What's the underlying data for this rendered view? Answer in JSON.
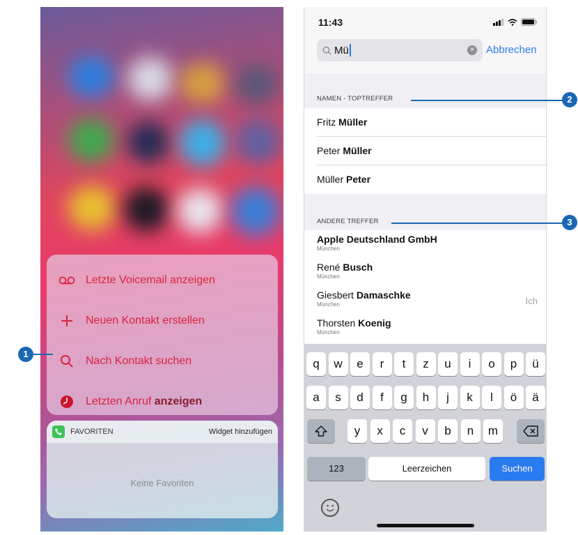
{
  "left_phone": {
    "quick_actions": [
      {
        "label": "Letzte Voicemail anzeigen",
        "icon": "voicemail-icon"
      },
      {
        "label": "Neuen Kontakt erstellen",
        "icon": "plus-icon"
      },
      {
        "label": "Nach Kontakt suchen",
        "icon": "search-icon"
      },
      {
        "label_part1": "Letzten Anruf ",
        "label_part2": "anzeigen",
        "icon": "clock-icon"
      }
    ],
    "widget": {
      "title": "FAVORITEN",
      "add_label": "Widget hinzufügen",
      "empty_text": "Keine Favoriten"
    }
  },
  "right_phone": {
    "status": {
      "time": "11:43"
    },
    "search": {
      "value": "Mü",
      "cancel_label": "Abbrechen"
    },
    "sections": [
      {
        "header": "NAMEN - TOPTREFFER",
        "rows": [
          {
            "first": "Fritz ",
            "bold": "Müller"
          },
          {
            "first": "Peter ",
            "bold": "Müller"
          },
          {
            "first": "Müller ",
            "bold": "Peter"
          }
        ]
      },
      {
        "header": "ANDERE TREFFER",
        "rows": [
          {
            "first": "",
            "bold": "Apple Deutschland GmbH",
            "sub": "München",
            "right": ""
          },
          {
            "first": "René ",
            "bold": "Busch",
            "sub": "München",
            "right": ""
          },
          {
            "first": "Giesbert ",
            "bold": "Damaschke",
            "sub": "München",
            "right": "Ich"
          },
          {
            "first": "Thorsten ",
            "bold": "Koenig",
            "sub": "München",
            "right": ""
          }
        ]
      }
    ],
    "keyboard": {
      "row1": [
        "q",
        "w",
        "e",
        "r",
        "t",
        "z",
        "u",
        "i",
        "o",
        "p",
        "ü"
      ],
      "row2": [
        "a",
        "s",
        "d",
        "f",
        "g",
        "h",
        "j",
        "k",
        "l",
        "ö",
        "ä"
      ],
      "row3": [
        "y",
        "x",
        "c",
        "v",
        "b",
        "n",
        "m"
      ],
      "numbers_label": "123",
      "space_label": "Leerzeichen",
      "return_label": "Suchen"
    }
  },
  "callouts": [
    "1",
    "2",
    "3"
  ],
  "colors": {
    "accent_red": "#d8243f",
    "ios_blue": "#2b7bf0",
    "callout_blue": "#1b67b4"
  }
}
